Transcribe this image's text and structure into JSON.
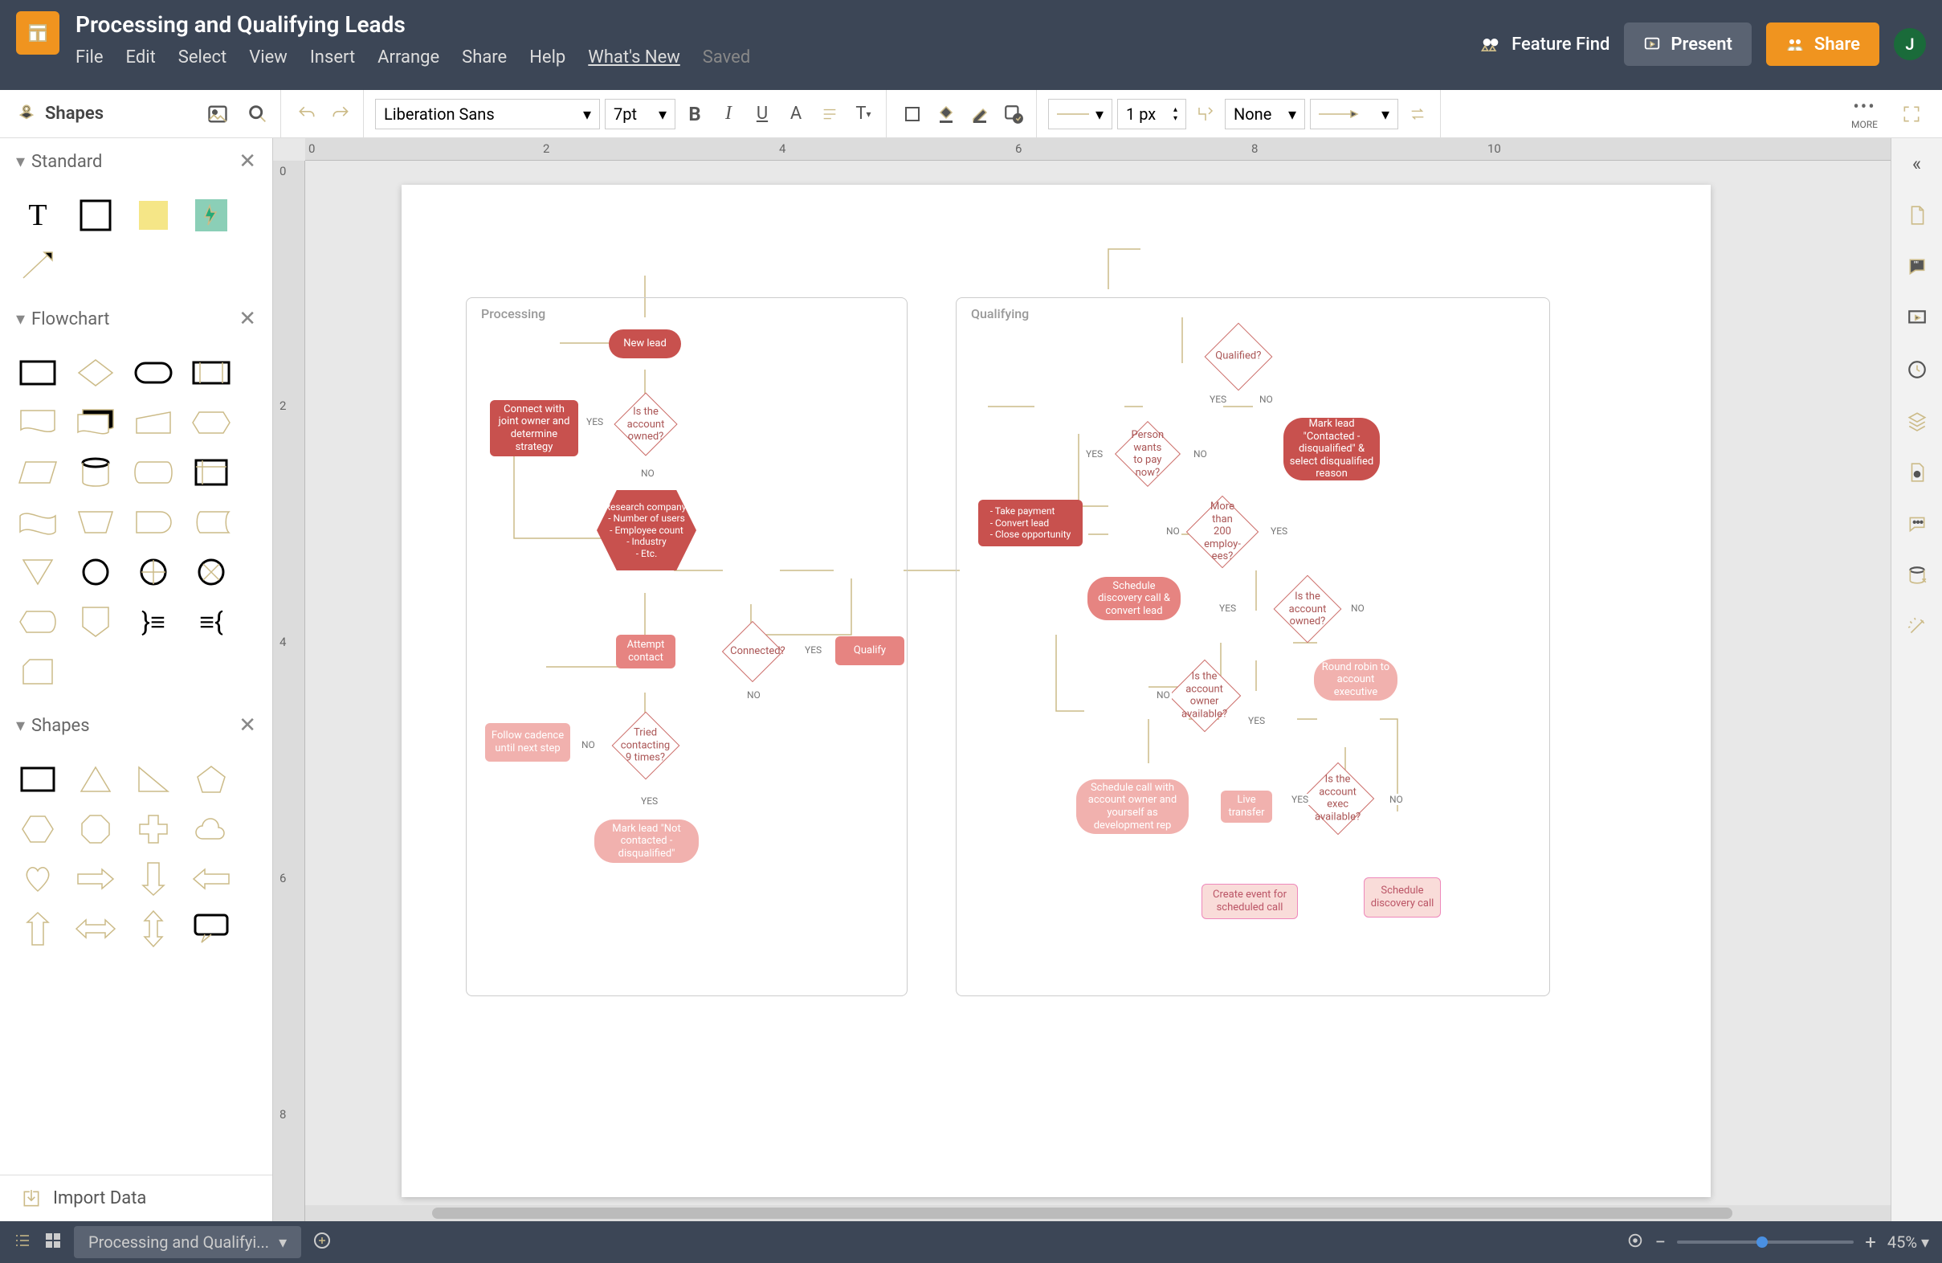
{
  "header": {
    "title": "Processing and Qualifying Leads",
    "menu": [
      "File",
      "Edit",
      "Select",
      "View",
      "Insert",
      "Arrange",
      "Share",
      "Help",
      "What's New"
    ],
    "saved": "Saved",
    "feature_find": "Feature Find",
    "present": "Present",
    "share": "Share",
    "avatar": "J"
  },
  "toolbar": {
    "shapes": "Shapes",
    "font": "Liberation Sans",
    "fontsize": "7pt",
    "lineWidth": "1 px",
    "lineStyle": "None",
    "more": "MORE"
  },
  "sidebar": {
    "sections": [
      "Standard",
      "Flowchart",
      "Shapes"
    ],
    "import": "Import Data"
  },
  "diagram": {
    "proc_label": "Processing",
    "qual_label": "Qualifying",
    "nodes": {
      "new_lead": "New lead",
      "account_owned": "Is the account owned?",
      "connect_owner": "Connect with joint owner and determine strategy",
      "research": "Research company:\n- Number of users\n- Employee count\n- Industry\n- Etc.",
      "attempt": "Attempt contact",
      "connected": "Connected?",
      "qualify": "Qualify",
      "tried9": "Tried contacting 9 times?",
      "cadence": "Follow cadence until next step",
      "not_contacted": "Mark lead \"Not contacted - disqualified\"",
      "qualified": "Qualified?",
      "mark_disq": "Mark lead \"Contacted - disqualified\" & select disqualified reason",
      "pay_now": "Person wants to pay now?",
      "take_payment": "- Take payment\n- Convert lead\n- Close opportunity",
      "more200": "More than 200 employ-ees?",
      "sched_disc": "Schedule discovery call & convert lead",
      "acct_owned2": "Is the account owned?",
      "owner_avail": "Is the account owner available?",
      "sched_owner": "Schedule call with account owner and yourself as development rep",
      "live_transfer": "Live transfer",
      "round_robin": "Round robin to account executive",
      "exec_avail": "Is the account exec available?",
      "create_event": "Create event for scheduled call",
      "sched_disc2": "Schedule discovery call"
    },
    "labels": {
      "yes": "YES",
      "no": "NO"
    }
  },
  "footer": {
    "tab": "Processing and Qualifyi...",
    "zoom": "45%"
  },
  "ruler": {
    "h": [
      "0",
      "2",
      "4",
      "6",
      "8",
      "10"
    ],
    "v": [
      "0",
      "2",
      "4",
      "6",
      "8"
    ]
  }
}
